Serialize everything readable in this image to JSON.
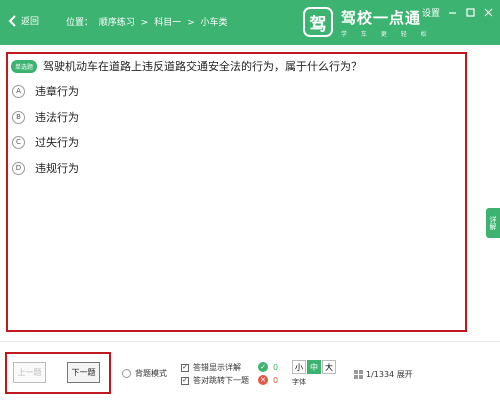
{
  "header": {
    "back_label": "返回",
    "breadcrumb": [
      "位置：",
      "顺序练习",
      ">",
      "科目一",
      ">",
      "小车类"
    ],
    "logo_char": "驾",
    "brand_name": "驾校一点通",
    "brand_slogan": "学 车 更 轻 松",
    "settings_label": "设置",
    "brand_color": "#3cb371"
  },
  "question": {
    "type_tag": "单选题",
    "text": "驾驶机动车在道路上违反道路交通安全法的行为，属于什么行为？",
    "options": [
      {
        "letter": "A",
        "text": "违章行为"
      },
      {
        "letter": "B",
        "text": "违法行为"
      },
      {
        "letter": "C",
        "text": "过失行为"
      },
      {
        "letter": "D",
        "text": "违规行为"
      }
    ]
  },
  "side_tab": {
    "label": "详解"
  },
  "bottom": {
    "prev_label": "上一题",
    "next_label": "下一题",
    "memorize_mode_label": "背题模式",
    "show_detail_on_wrong_label": "答错显示详解",
    "jump_next_on_right_label": "答对跳转下一题",
    "correct_count": "0",
    "wrong_count": "0",
    "font_sizes": [
      "小",
      "中",
      "大"
    ],
    "font_size_selected": "中",
    "font_label": "字体",
    "progress_text": "1/1334 展开"
  }
}
